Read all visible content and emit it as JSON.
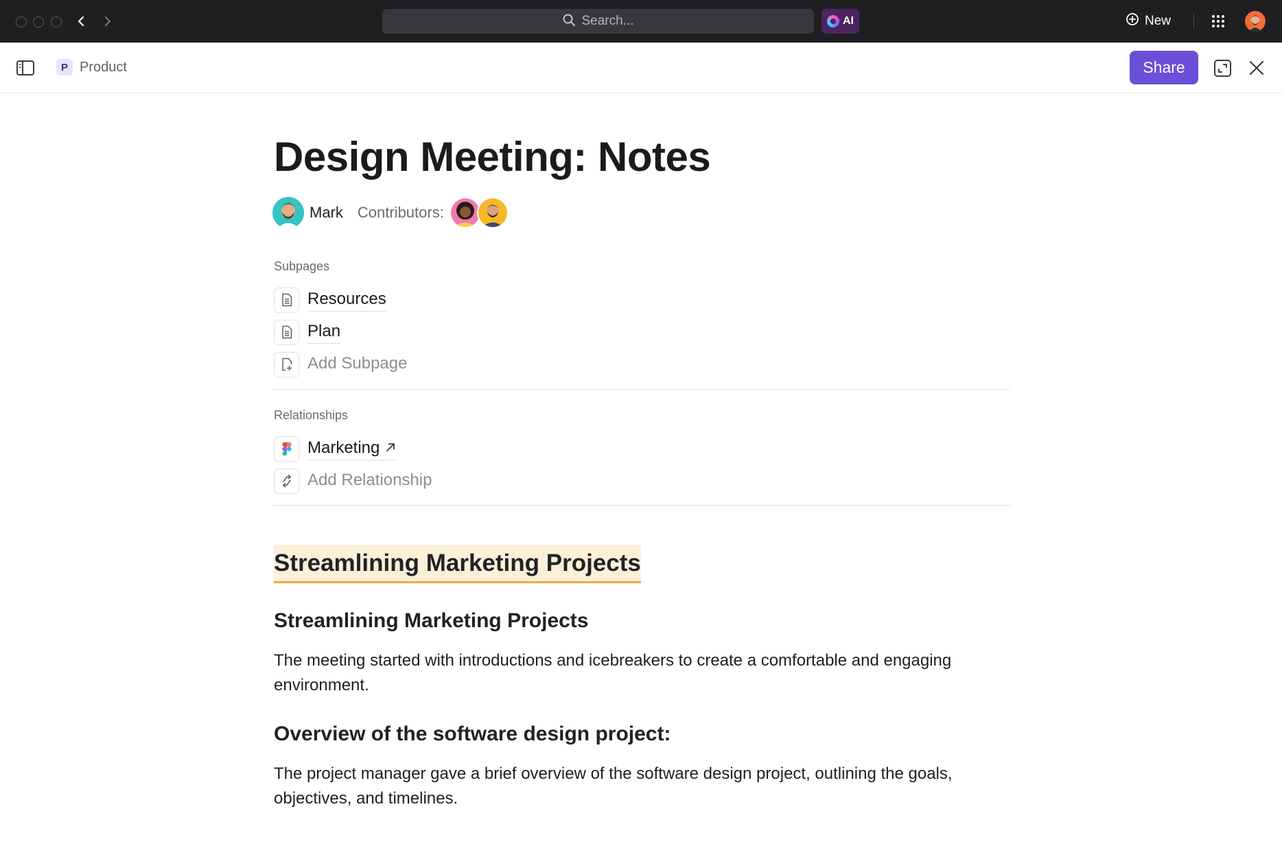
{
  "topbar": {
    "search_placeholder": "Search...",
    "ai_label": "AI",
    "new_label": "New"
  },
  "header": {
    "space_initial": "P",
    "breadcrumb": "Product",
    "share_label": "Share"
  },
  "doc": {
    "title": "Design Meeting: Notes",
    "author": "Mark",
    "contributors_label": "Contributors:",
    "subpages_label": "Subpages",
    "subpages": [
      {
        "label": "Resources",
        "icon": "document-icon"
      },
      {
        "label": "Plan",
        "icon": "document-icon"
      }
    ],
    "add_subpage_label": "Add Subpage",
    "relationships_label": "Relationships",
    "relationships": [
      {
        "label": "Marketing",
        "icon": "figma-icon"
      }
    ],
    "add_relationship_label": "Add Relationship",
    "highlight_heading": "Streamlining Marketing Projects",
    "sections": [
      {
        "heading": "Streamlining Marketing Projects",
        "body": "The meeting started with introductions and icebreakers to create a comfortable and engaging environment."
      },
      {
        "heading": "Overview of the software design project:",
        "body": "The project manager gave a brief overview of the software design project, outlining the goals, objectives, and timelines."
      }
    ]
  },
  "colors": {
    "topbar_bg": "#1f1f22",
    "accent": "#6a4fd8",
    "highlight_bg": "#fdf0d9",
    "highlight_underline": "#f3a93a"
  }
}
